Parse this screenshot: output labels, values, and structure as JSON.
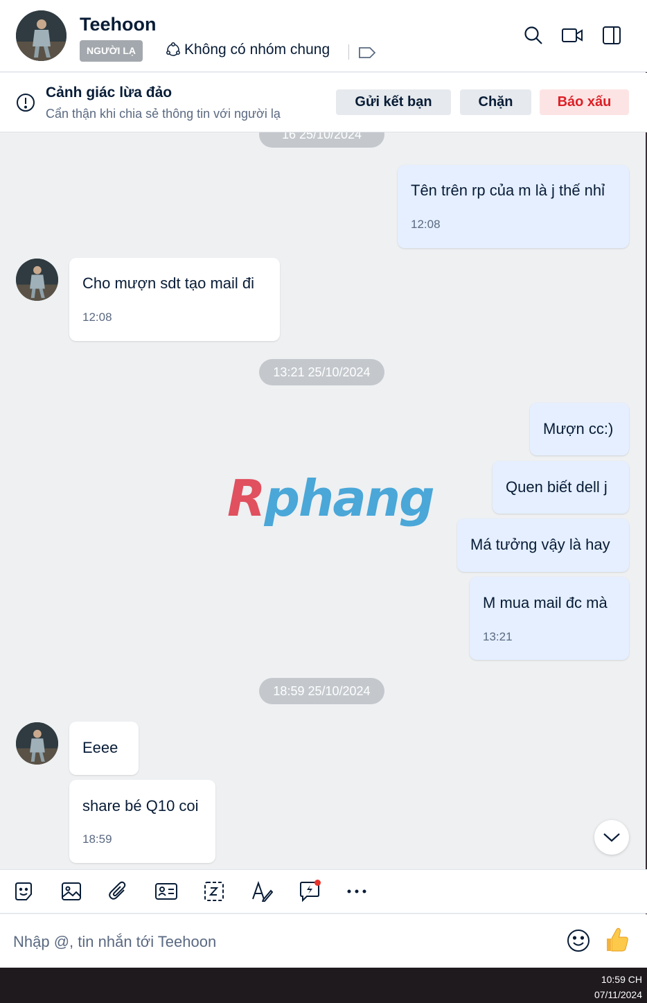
{
  "header": {
    "name": "Teehoon",
    "badge": "NGƯỜI LẠ",
    "groups": "Không có nhóm chung"
  },
  "warning": {
    "title": "Cảnh giác lừa đảo",
    "subtitle": "Cẩn thận khi chia sẻ thông tin với người lạ",
    "add_friend": "Gửi kết bạn",
    "block": "Chặn",
    "report": "Báo xấu"
  },
  "chat": {
    "ts1": "16 25/10/2024",
    "m1_text": "Tên trên rp của m là j thế nhỉ",
    "m1_time": "12:08",
    "m2_text": "Cho mượn sdt tạo mail đi",
    "m2_time": "12:08",
    "ts2": "13:21 25/10/2024",
    "m3_text": "Mượn cc:)",
    "m4_text": "Quen biết dell j",
    "m5_text": "Má tưởng vậy là hay",
    "m6_text": "M mua mail đc mà",
    "m6_time": "13:21",
    "ts3": "18:59 25/10/2024",
    "m7_text": "Eeee",
    "m8_text": "share bé Q10 coi",
    "m8_time": "18:59"
  },
  "watermark": {
    "r": "R",
    "rest": "phang"
  },
  "composer": {
    "placeholder": "Nhập @, tin nhắn tới Teehoon"
  },
  "taskbar": {
    "time": "10:59 CH",
    "date": "07/11/2024"
  },
  "colors": {
    "my_bubble": "#e5efff",
    "their_bubble": "#ffffff",
    "report_red": "#dc1f26",
    "background": "#eef0f2"
  }
}
